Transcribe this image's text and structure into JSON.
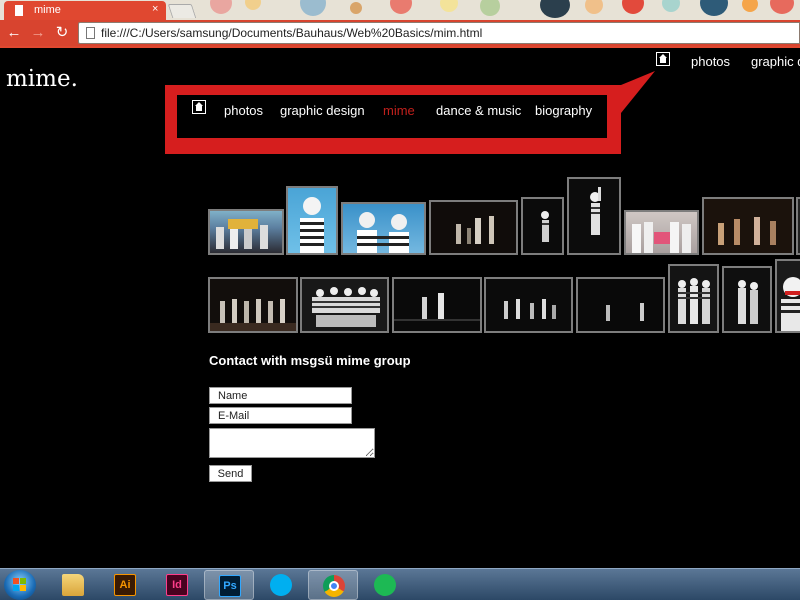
{
  "browser": {
    "tab": {
      "title": "mime",
      "close": "×"
    },
    "nav": {
      "back": "←",
      "forward": "→",
      "reload": "↻"
    },
    "address": {
      "url": "file:///C:/Users/samsung/Documents/Bauhaus/Web%20Basics/mim.html"
    }
  },
  "page": {
    "logo": "mime.",
    "top_nav": {
      "home_icon": "home-icon",
      "items": [
        {
          "label": "photos"
        },
        {
          "label": "graphic d"
        }
      ]
    },
    "menu": {
      "highlight_color": "#d61e1e",
      "home_icon": "home-icon",
      "items": [
        {
          "label": "photos",
          "active": false
        },
        {
          "label": "graphic design",
          "active": false
        },
        {
          "label": "mime",
          "active": true
        },
        {
          "label": "dance & music",
          "active": false
        },
        {
          "label": "biography",
          "active": false
        }
      ]
    },
    "gallery": {
      "rows": [
        {
          "photos": [
            {
              "desc": "mime performers group outdoor"
            },
            {
              "desc": "mime girl blue sky"
            },
            {
              "desc": "two mimes blue background"
            },
            {
              "desc": "stage dancers dark"
            },
            {
              "desc": "mime solo spotlight"
            },
            {
              "desc": "mime standing arm raised"
            },
            {
              "desc": "mime group with sign"
            },
            {
              "desc": "stage group performance"
            },
            {
              "desc": "edge partial"
            }
          ]
        },
        {
          "photos": [
            {
              "desc": "stage line of mimes"
            },
            {
              "desc": "mime group portrait"
            },
            {
              "desc": "mimes on dark stage"
            },
            {
              "desc": "group on stage"
            },
            {
              "desc": "dark stage pair"
            },
            {
              "desc": "three mimes"
            },
            {
              "desc": "mime portrait"
            },
            {
              "desc": "mime close up red"
            }
          ]
        }
      ]
    },
    "contact": {
      "title": "Contact with msgsü mime group",
      "name_placeholder": "Name",
      "email_placeholder": "E-Mail",
      "send_label": "Send"
    }
  },
  "taskbar": {
    "apps": [
      {
        "name": "start-button"
      },
      {
        "name": "explorer-icon"
      },
      {
        "name": "illustrator-icon",
        "label": "Ai"
      },
      {
        "name": "indesign-icon",
        "label": "Id"
      },
      {
        "name": "photoshop-icon",
        "label": "Ps"
      },
      {
        "name": "skype-icon"
      },
      {
        "name": "chrome-icon"
      },
      {
        "name": "spotify-icon"
      }
    ]
  }
}
